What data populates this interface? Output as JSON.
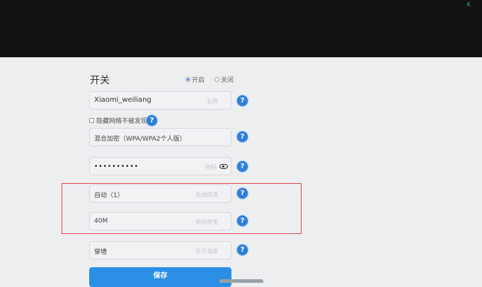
{
  "header": {
    "dots": "· · ·",
    "corner_mark": "K"
  },
  "wifi_switch": {
    "title": "开关",
    "on_label": "开启",
    "off_label": "关闭",
    "selected": "on"
  },
  "ssid": {
    "value": "Xiaomi_weiliang",
    "placeholder": "名称"
  },
  "hide_network": {
    "label": "隐藏网络不被发现",
    "checked": false
  },
  "encryption": {
    "value": "混合加密（WPA/WPA2个人版）"
  },
  "password": {
    "value": "••••••••••",
    "placeholder": "密码"
  },
  "channel": {
    "value": "自动（1）",
    "placeholder": "无线信道"
  },
  "bandwidth": {
    "value": "40M",
    "placeholder": "频段带宽"
  },
  "signal_strength": {
    "value": "穿墙",
    "placeholder": "信号强度"
  },
  "help_glyph": "?",
  "save_label": "保存",
  "colors": {
    "accent": "#2b8fe6",
    "highlight_box": "#e0474c",
    "header_bg": "#121212"
  }
}
